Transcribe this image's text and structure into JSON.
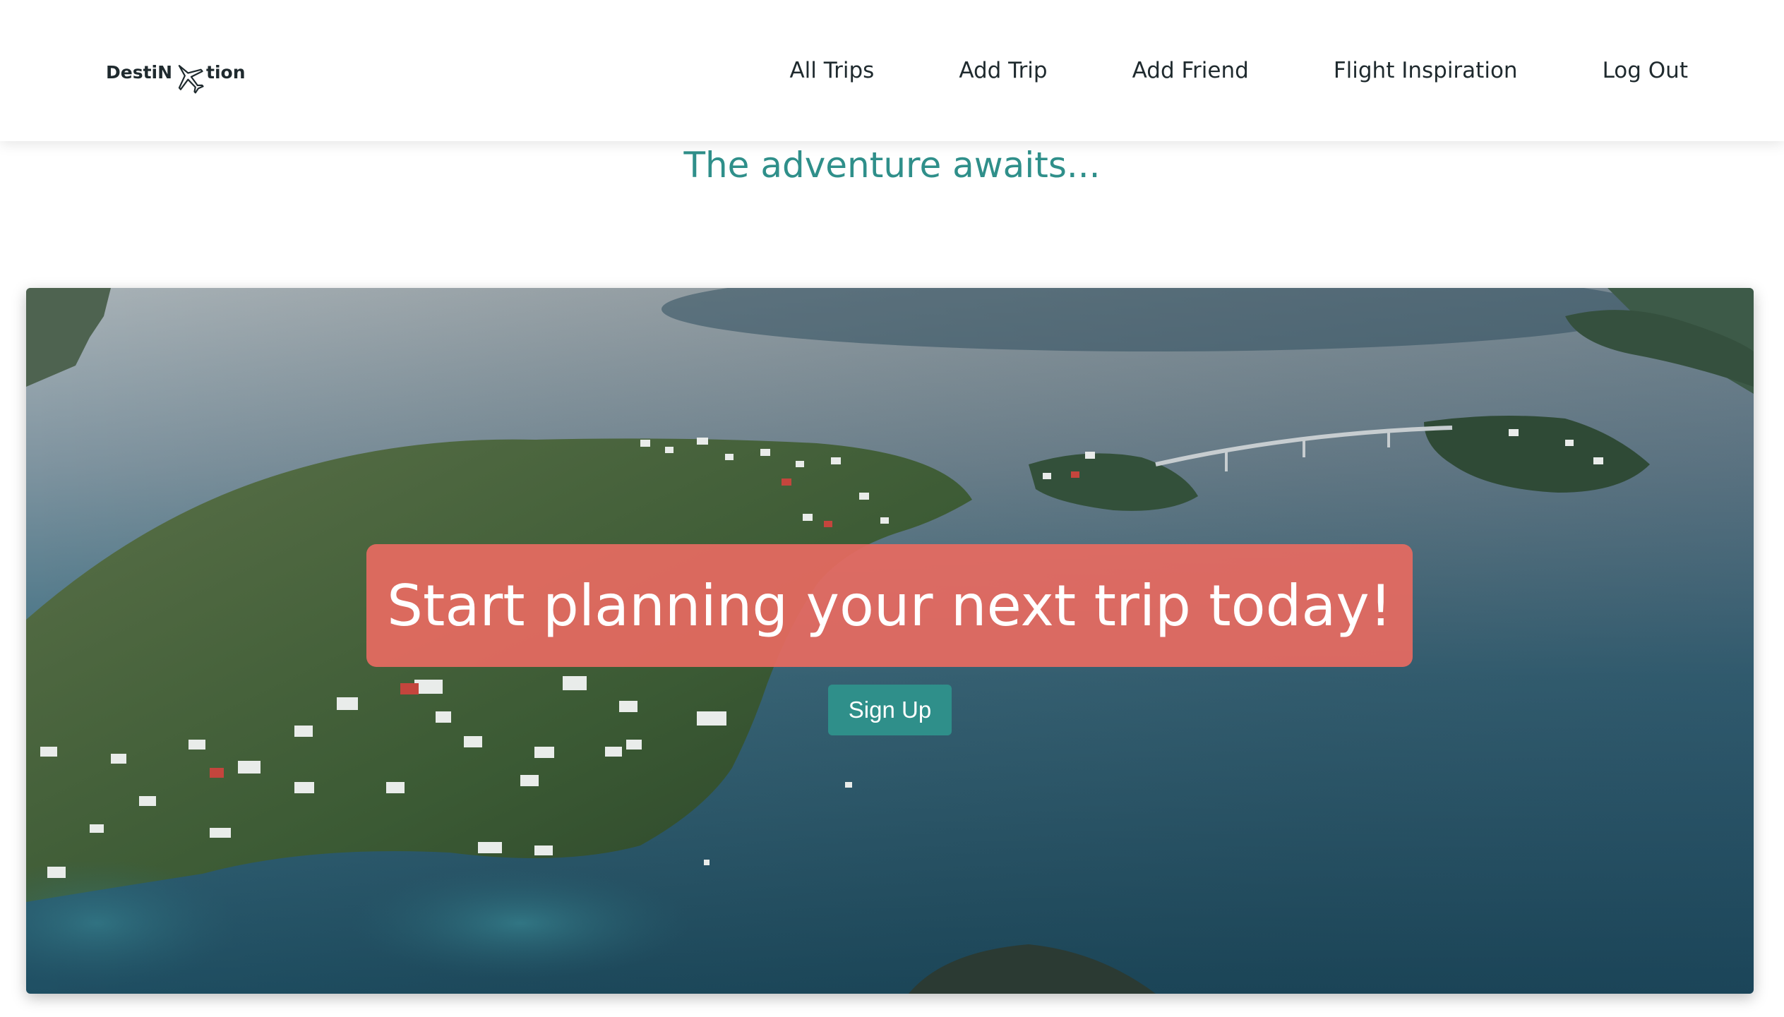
{
  "brand": {
    "part_a": "DestiN",
    "part_b": "tion",
    "logo_icon": "airplane-icon"
  },
  "nav": {
    "items": [
      {
        "label": "All Trips"
      },
      {
        "label": "Add Trip"
      },
      {
        "label": "Add Friend"
      },
      {
        "label": "Flight Inspiration"
      },
      {
        "label": "Log Out"
      }
    ]
  },
  "tagline": "The adventure awaits...",
  "hero": {
    "headline": "Start planning your next trip today!",
    "cta_label": "Sign Up",
    "image": "aerial-coastal-village-photo"
  },
  "colors": {
    "accent_teal": "#2f8f8a",
    "banner_coral": "#e66b61",
    "nav_text": "#1f2a2e"
  }
}
